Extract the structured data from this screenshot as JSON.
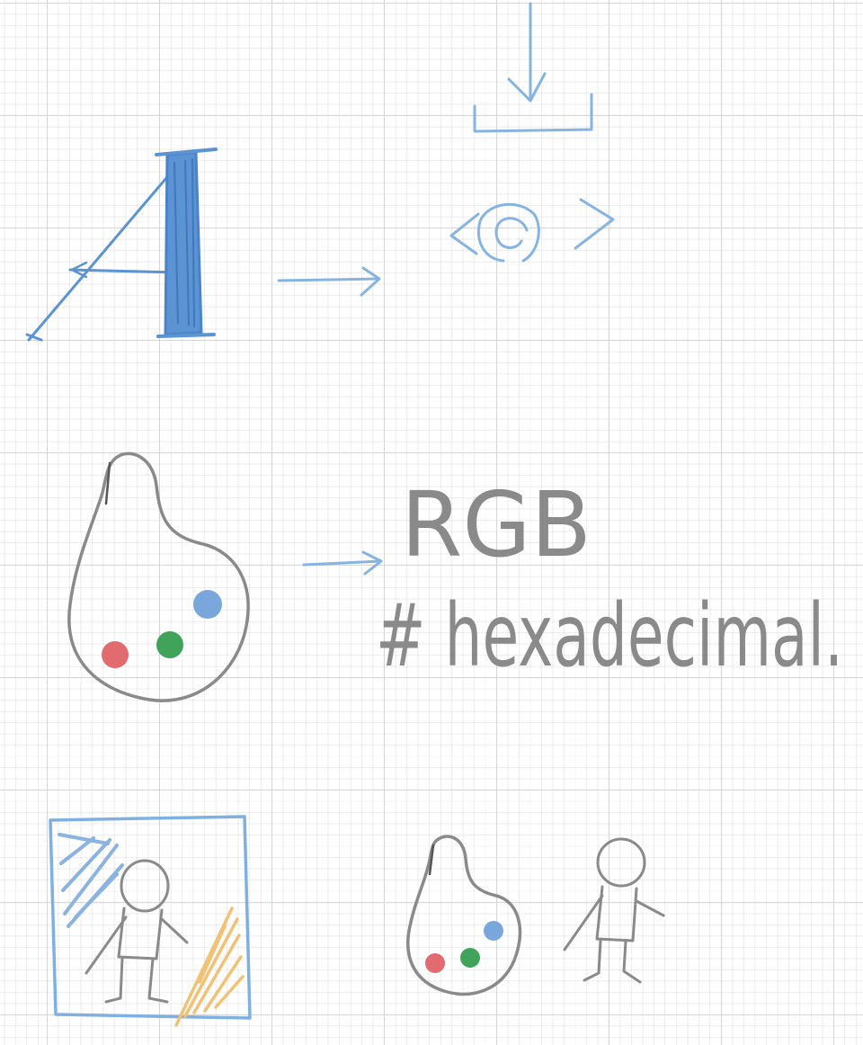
{
  "notes": {
    "rgb_label": "RGB",
    "hex_label": "# hexadecimal."
  },
  "colors": {
    "ink_blue": "#5b93d3",
    "ink_light_blue": "#86b4e2",
    "ink_gray": "#8a8a8a",
    "dot_red": "#e26b70",
    "dot_green": "#3fa35a",
    "dot_blue": "#7aa7db",
    "hatch_blue": "#8ab3e0",
    "hatch_yellow": "#efc275"
  }
}
